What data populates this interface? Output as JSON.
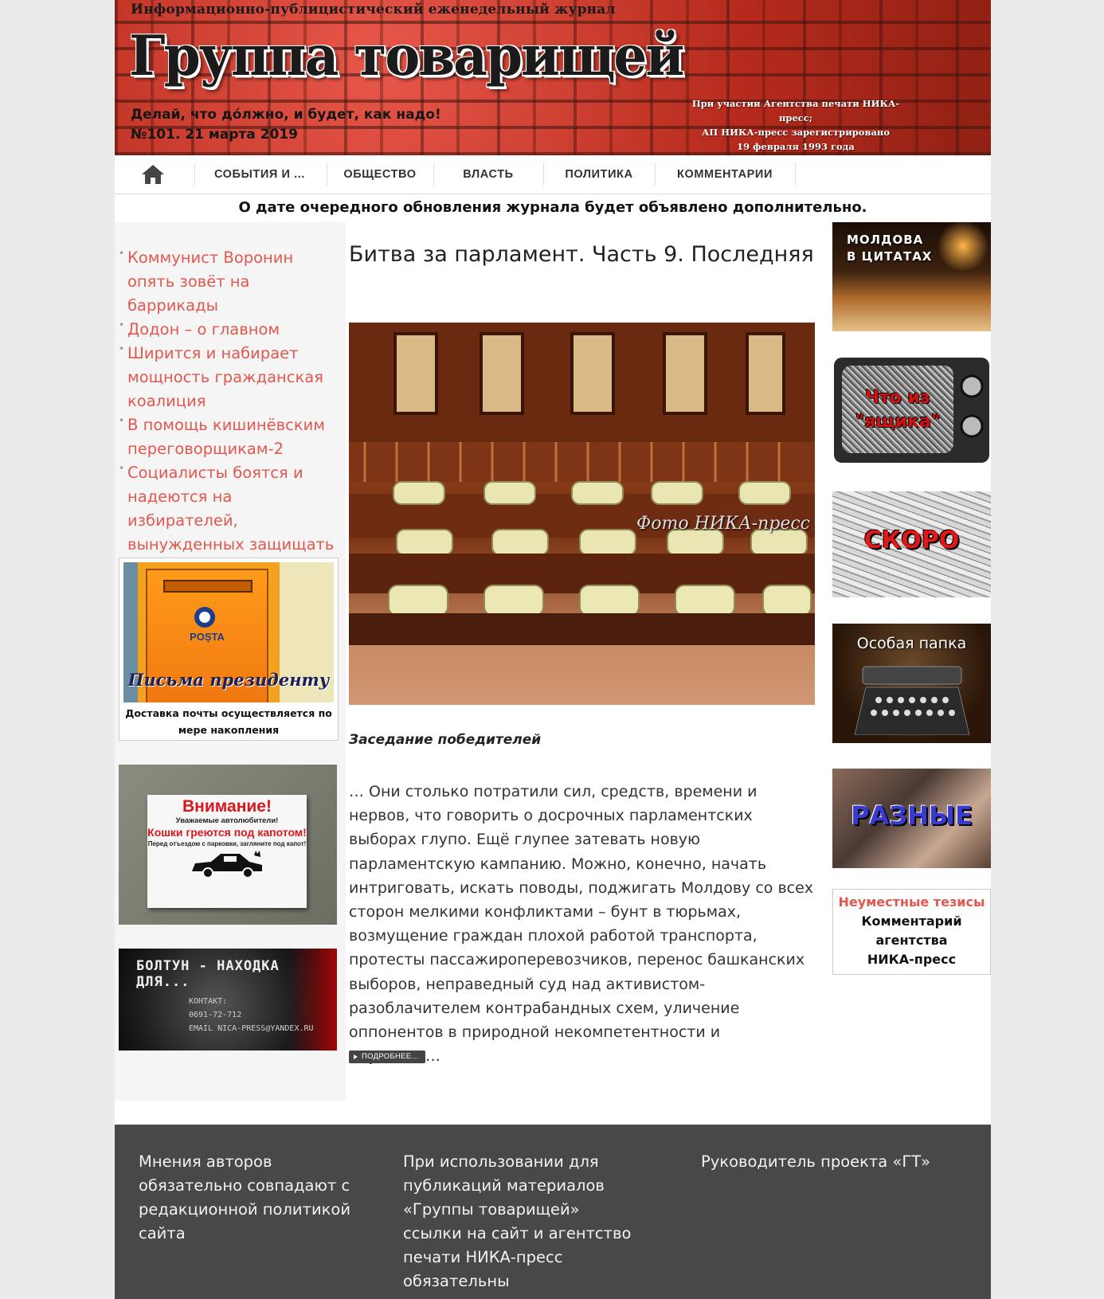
{
  "header": {
    "tagline_top": "Информационно-публицистический еженедельный журнал",
    "logo_text": "Группа товарищей",
    "motto": "Делай, что до́лжно, и будет, как надо!",
    "issue": "№101. 21 марта 2019",
    "agency_note": [
      "При участии Агентства печати НИКА-пресс;",
      "АП НИКА-пресс зарегистрировано",
      "19 февраля 1993 года"
    ]
  },
  "nav": {
    "home_icon": "home-icon",
    "items": [
      "СОБЫТИЯ И ...",
      "ОБЩЕСТВО",
      "ВЛАСТЬ",
      "ПОЛИТИКА",
      "КОММЕНТАРИИ"
    ]
  },
  "notice": "О дате очередного обновления журнала будет объявлено дополнительно.",
  "sidebar_left": {
    "news": [
      "Коммунист Воронин опять зовёт на баррикады",
      "Додон – о главном",
      "Ширится и набирает мощность гражданская коалиция",
      "В помощь кишинёвским переговорщикам-2",
      "Социалисты боятся и надеются на избирателей, вынужденных защищать свои интересы"
    ],
    "letters": {
      "box_brand": "POȘTA",
      "title": "Письма президенту",
      "caption": "Доставка почты осуществляется по мере накопления"
    },
    "warning": {
      "title": "Внимание!",
      "line1": "Уважаемые автолюбители!",
      "line2": "Кошки греются под капотом!",
      "line3": "Перед отъездом с парковки, загляните под капот!"
    },
    "phone_banner": {
      "title": "БОЛТУН - НАХОДКА ДЛЯ...",
      "contact_label": "КОНТАКТ:",
      "phone": "0691-72-712",
      "email": "EMAIL NICA-PRESS@YANDEX.RU"
    }
  },
  "article": {
    "title": "Битва за парламент. Часть 9. Последняя",
    "photo_credit": "Фото НИКА-пресс",
    "subhead": "Заседание победителей",
    "lead": "… Они столько потратили сил, средств, времени и нервов, что говорить о досрочных парламентских выборах глупо. Ещё глупее затевать новую парламентскую кампанию. Можно, конечно, начать интриговать, искать поводы, поджигать Молдову со всех сторон мелкими конфликтами – бунт в тюрьмах, возмущение граждан плохой работой транспорта, протесты пассажироперевозчиков, перенос башканских выборов, неправедный суд над активистом-разоблачителем контрабандных схем, уличение оппонентов в природной некомпетентности и двуличии…",
    "more_label": "ПОДРОБНЕЕ…"
  },
  "sidebar_right": {
    "banners": [
      "МОЛДОВА В ЦИТАТАХ",
      "Что из \"ящика\"",
      "СКОРО",
      "Особая папка",
      "РАЗНЫЕ"
    ],
    "thesis": {
      "title": "Неуместные тезисы",
      "text": "Комментарий агентства НИКА-пресс"
    }
  },
  "footer": {
    "col1": "Мнения авторов обязательно совпадают с редакционной политикой сайта",
    "col2": "При использовании для публикаций материалов «Группы товарищей» ссылки на сайт и агентство печати НИКА-пресс обязательны",
    "col3": "Руководитель проекта «ГТ»"
  },
  "colors": {
    "link_red": "#e2584f",
    "footer_bg": "#484848",
    "header_brick": "#c8321e"
  }
}
